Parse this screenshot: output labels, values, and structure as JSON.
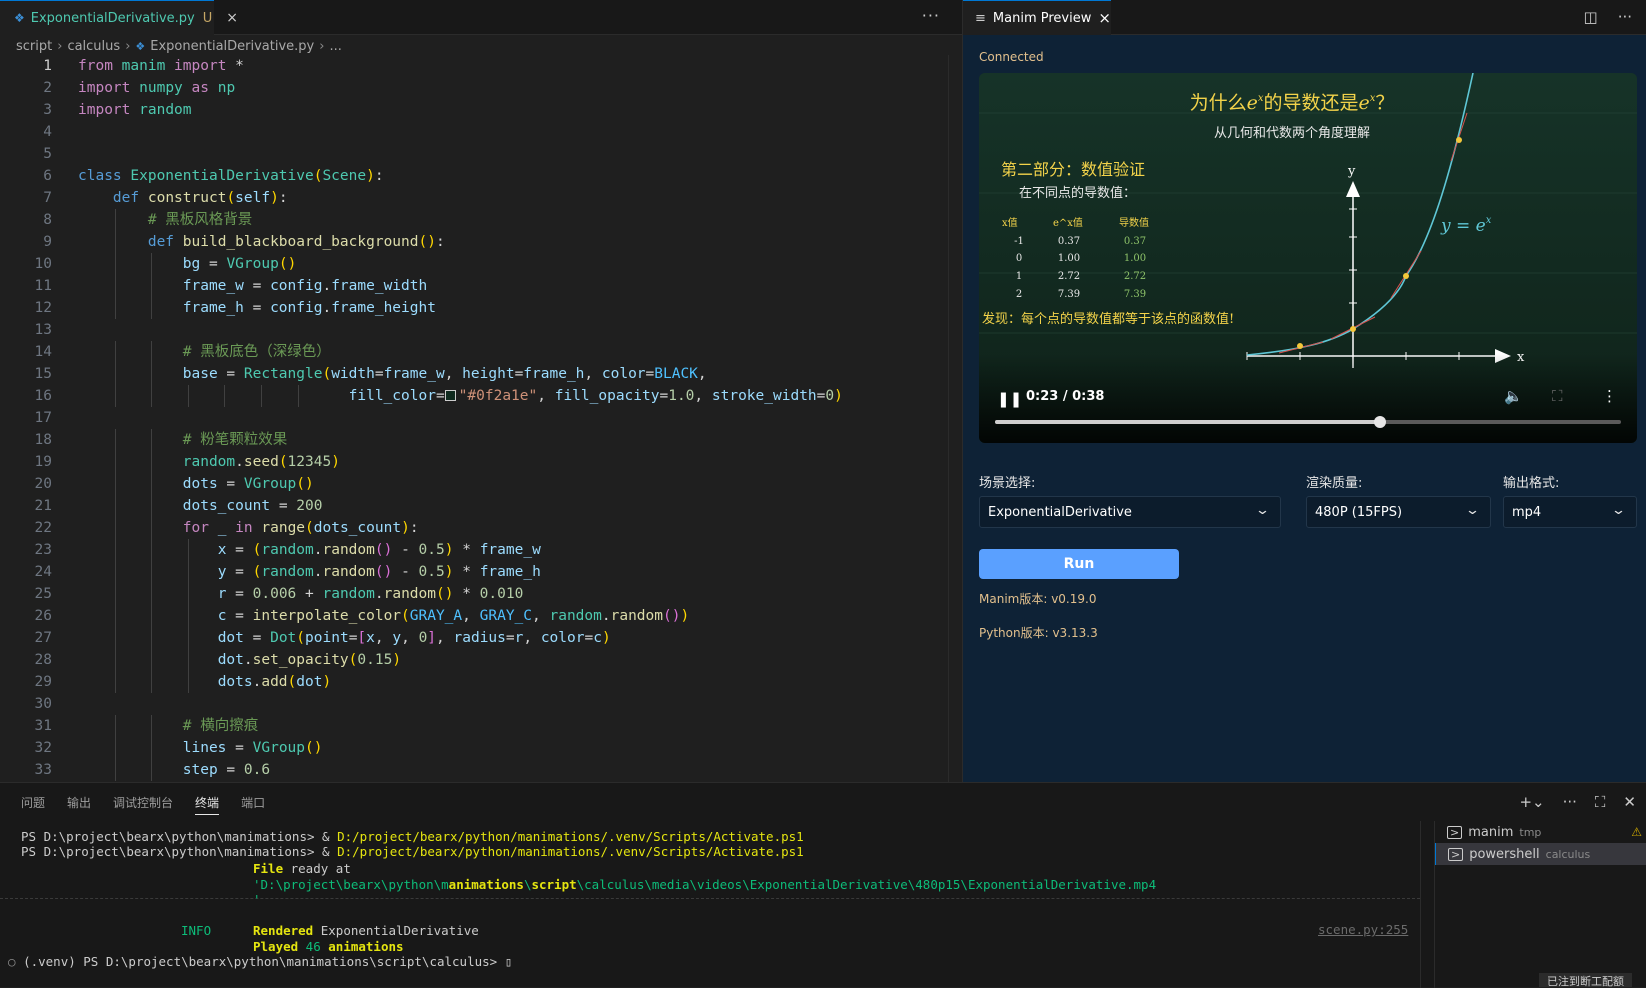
{
  "editor": {
    "tab": {
      "filename": "ExponentialDerivative.py",
      "modified": "U",
      "close": "×"
    },
    "more": "···",
    "breadcrumb": [
      "script",
      "calculus",
      "ExponentialDerivative.py",
      "..."
    ]
  },
  "code_lines": [
    "from manim import *",
    "import numpy as np",
    "import random",
    "",
    "",
    "class ExponentialDerivative(Scene):",
    "    def construct(self):",
    "        # 黑板风格背景",
    "        def build_blackboard_background():",
    "            bg = VGroup()",
    "            frame_w = config.frame_width",
    "            frame_h = config.frame_height",
    "",
    "            # 黑板底色（深绿色）",
    "            base = Rectangle(width=frame_w, height=frame_h, color=BLACK,",
    "                               fill_color=\"#0f2a1e\", fill_opacity=1.0, stroke_width=0)",
    "",
    "            # 粉笔颗粒效果",
    "            random.seed(12345)",
    "            dots = VGroup()",
    "            dots_count = 200",
    "            for _ in range(dots_count):",
    "                x = (random.random() - 0.5) * frame_w",
    "                y = (random.random() - 0.5) * frame_h",
    "                r = 0.006 + random.random() * 0.010",
    "                c = interpolate_color(GRAY_A, GRAY_C, random.random())",
    "                dot = Dot(point=[x, y, 0], radius=r, color=c)",
    "                dot.set_opacity(0.15)",
    "                dots.add(dot)",
    "",
    "            # 横向擦痕",
    "            lines = VGroup()",
    "            step = 0.6"
  ],
  "preview": {
    "tab_title": "Manim Preview",
    "tab_close": "×",
    "connection_status": "Connected",
    "video": {
      "title_a": "为什么",
      "title_b": "的导数还是",
      "title_c": "？",
      "exp_base": "e",
      "exp_sup": "x",
      "subtitle": "从几何和代数两个角度理解",
      "section_heading": "第二部分：数值验证",
      "section_sub": "在不同点的导数值：",
      "table_headers": [
        "x值",
        "e^x值",
        "导数值"
      ],
      "table_rows": [
        [
          "-1",
          "0.37",
          "0.37"
        ],
        [
          "0",
          "1.00",
          "1.00"
        ],
        [
          "1",
          "2.72",
          "2.72"
        ],
        [
          "2",
          "7.39",
          "7.39"
        ]
      ],
      "finding": "发现：每个点的导数值都等于该点的函数值!",
      "curve_label": "y = e",
      "curve_label_sup": "x",
      "axis_x": "x",
      "axis_y": "y",
      "time": "0:23 / 0:38",
      "progress": 0.615
    },
    "scene_label": "场景选择:",
    "scene_value": "ExponentialDerivative",
    "quality_label": "渲染质量:",
    "quality_value": "480P (15FPS)",
    "format_label": "输出格式:",
    "format_value": "mp4",
    "run_button": "Run",
    "manim_version": "Manim版本: v0.19.0",
    "python_version": "Python版本: v3.13.3"
  },
  "panel": {
    "tabs": [
      "问题",
      "输出",
      "调试控制台",
      "终端",
      "端口"
    ],
    "active_tab": "终端",
    "terminals": [
      {
        "name": "manim",
        "sub": "tmp",
        "warning": true
      },
      {
        "name": "powershell",
        "sub": "calculus",
        "selected": true
      }
    ],
    "badge": "已注到断工配额"
  },
  "terminal": {
    "line1_prompt": "PS D:\\project\\bearx\\python\\manimations> ",
    "line1_amp": "& ",
    "line1_path": "D:/project/bearx/python/manimations/.venv/Scripts/Activate.ps1",
    "line2_prompt": "PS D:\\project\\bearx\\python\\manimations> ",
    "line2_amp": "& ",
    "line2_path": "D:/project/bearx/python/manimations/.venv/Scripts/Activate.ps1",
    "file_ready": "File",
    "file_ready_rest": " ready at",
    "path_a": "'D:\\project\\bearx\\python\\m",
    "path_b": "animations",
    "path_c": "\\",
    "path_d": "script",
    "path_e": "\\calculus\\media\\videos\\ExponentialDerivative\\480p15\\ExponentialDerivative.mp4",
    "path_end": "'",
    "info": "INFO",
    "rendered": "Rendered",
    "rendered_name": " ExponentialDerivative",
    "played": "Played",
    "played_count": " 46 ",
    "played_word": "animations",
    "source": "scene.py:255",
    "last_prompt": "(.venv) PS D:\\project\\bearx\\python\\manimations\\script\\calculus> "
  }
}
